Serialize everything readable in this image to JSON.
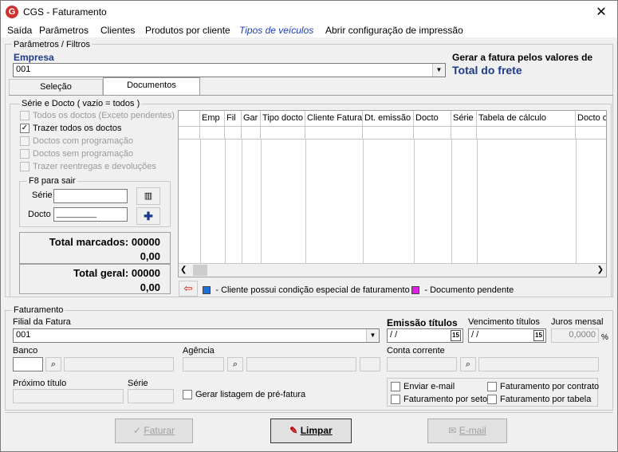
{
  "window": {
    "title": "CGS - Faturamento",
    "logo_text": "G"
  },
  "menu": [
    "Saída",
    "Parâmetros",
    "Clientes",
    "Produtos por cliente",
    "Tipos de veículos",
    "Abrir configuração de impressão"
  ],
  "params": {
    "legend": "Parâmetros / Filtros",
    "empresa_label": "Empresa",
    "empresa_value": "001",
    "gerar_label": "Gerar a fatura pelos valores de",
    "gerar_value": "Total do frete"
  },
  "tabs": [
    "Seleção",
    "Documentos"
  ],
  "serie_docto": {
    "legend": "Série e Docto ( vazio = todos )",
    "options": [
      {
        "label": "Todos os doctos (Exceto pendentes)",
        "checked": false,
        "enabled": false
      },
      {
        "label": "Trazer todos os doctos",
        "checked": true,
        "enabled": true
      },
      {
        "label": "Doctos com programação",
        "checked": false,
        "enabled": false
      },
      {
        "label": "Doctos sem programação",
        "checked": false,
        "enabled": false
      },
      {
        "label": "Trazer reentregas e devoluções",
        "checked": false,
        "enabled": false
      }
    ],
    "f8_legend": "F8 para sair",
    "serie_label": "Série",
    "docto_label": "Docto",
    "docto_value": "__________",
    "total_marcados_label": "Total marcados: 00000",
    "total_marcados_value": "0,00",
    "total_geral_label": "Total geral: 00000",
    "total_geral_value": "0,00"
  },
  "grid": {
    "columns": [
      "",
      "Emp",
      "Fil",
      "Gar",
      "Tipo docto",
      "Cliente Fatura",
      "Dt. emissão",
      "Docto",
      "Série",
      "Tabela de cálculo",
      "Docto o"
    ]
  },
  "legend_bar": {
    "cliente_especial": "- Cliente possui condição especial de faturamento",
    "documento_pendente": "- Documento pendente",
    "colors": {
      "cliente_especial": "#1e6fd9",
      "documento_pendente": "#e020e0"
    }
  },
  "faturamento": {
    "legend": "Faturamento",
    "filial_label": "Filial da Fatura",
    "filial_value": "001",
    "emissao_label": "Emissão títulos",
    "emissao_value": "/ /",
    "vencimento_label": "Vencimento títulos",
    "vencimento_value": "/ /",
    "juros_label": "Juros mensal",
    "juros_value": "0,0000",
    "juros_unit": "%",
    "calendar_label": "15",
    "banco_label": "Banco",
    "agencia_label": "Agência",
    "conta_label": "Conta corrente",
    "proximo_label": "Próximo título",
    "serie_label": "Série",
    "gerar_listagem_label": "Gerar listagem de pré-fatura",
    "opcoes": [
      {
        "label": "Enviar e-mail",
        "checked": false
      },
      {
        "label": "Faturamento por contrato",
        "checked": false
      },
      {
        "label": "Faturamento por setor",
        "checked": false
      },
      {
        "label": "Faturamento por tabela",
        "checked": false
      }
    ]
  },
  "buttons": {
    "faturar": "Faturar",
    "limpar": "Limpar",
    "email": "E-mail"
  }
}
